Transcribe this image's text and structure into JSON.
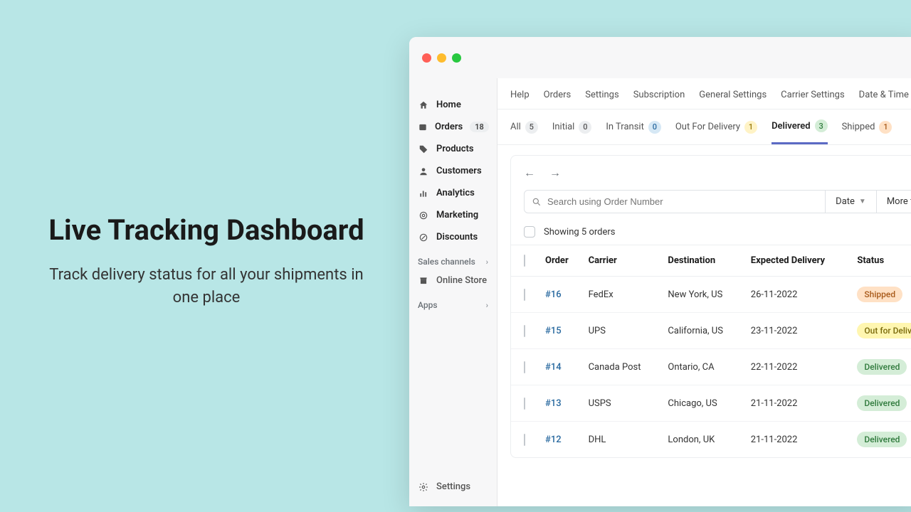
{
  "hero": {
    "title": "Live Tracking Dashboard",
    "subtitle": "Track delivery status for all your shipments in one place"
  },
  "sidebar": {
    "items": [
      {
        "label": "Home"
      },
      {
        "label": "Orders",
        "badge": "18"
      },
      {
        "label": "Products"
      },
      {
        "label": "Customers"
      },
      {
        "label": "Analytics"
      },
      {
        "label": "Marketing"
      },
      {
        "label": "Discounts"
      }
    ],
    "sales_channels_label": "Sales channels",
    "online_store_label": "Online Store",
    "apps_label": "Apps",
    "settings_label": "Settings"
  },
  "topnav": [
    "Help",
    "Orders",
    "Settings",
    "Subscription",
    "General Settings",
    "Carrier Settings",
    "Date & Time Settings"
  ],
  "tabs": [
    {
      "label": "All",
      "count": "5",
      "pill": "gray"
    },
    {
      "label": "Initial",
      "count": "0",
      "pill": "gray"
    },
    {
      "label": "In Transit",
      "count": "0",
      "pill": "blue"
    },
    {
      "label": "Out For Delivery",
      "count": "1",
      "pill": "yellow"
    },
    {
      "label": "Delivered",
      "count": "3",
      "pill": "green",
      "active": true
    },
    {
      "label": "Shipped",
      "count": "1",
      "pill": "orange"
    }
  ],
  "search": {
    "placeholder": "Search using Order Number"
  },
  "filters": {
    "date_label": "Date",
    "more_label": "More filters"
  },
  "summary": "Showing 5 orders",
  "columns": {
    "order": "Order",
    "carrier": "Carrier",
    "destination": "Destination",
    "expected": "Expected Delivery",
    "status": "Status"
  },
  "rows": [
    {
      "order": "#16",
      "carrier": "FedEx",
      "destination": "New York, US",
      "expected": "26-11-2022",
      "status": "Shipped",
      "status_class": "sb-shipped"
    },
    {
      "order": "#15",
      "carrier": "UPS",
      "destination": "California, US",
      "expected": "23-11-2022",
      "status": "Out for Delivery",
      "status_class": "sb-ofd"
    },
    {
      "order": "#14",
      "carrier": "Canada Post",
      "destination": "Ontario, CA",
      "expected": "22-11-2022",
      "status": "Delivered",
      "status_class": "sb-delivered"
    },
    {
      "order": "#13",
      "carrier": "USPS",
      "destination": "Chicago, US",
      "expected": "21-11-2022",
      "status": "Delivered",
      "status_class": "sb-delivered"
    },
    {
      "order": "#12",
      "carrier": "DHL",
      "destination": "London, UK",
      "expected": "21-11-2022",
      "status": "Delivered",
      "status_class": "sb-delivered"
    }
  ]
}
